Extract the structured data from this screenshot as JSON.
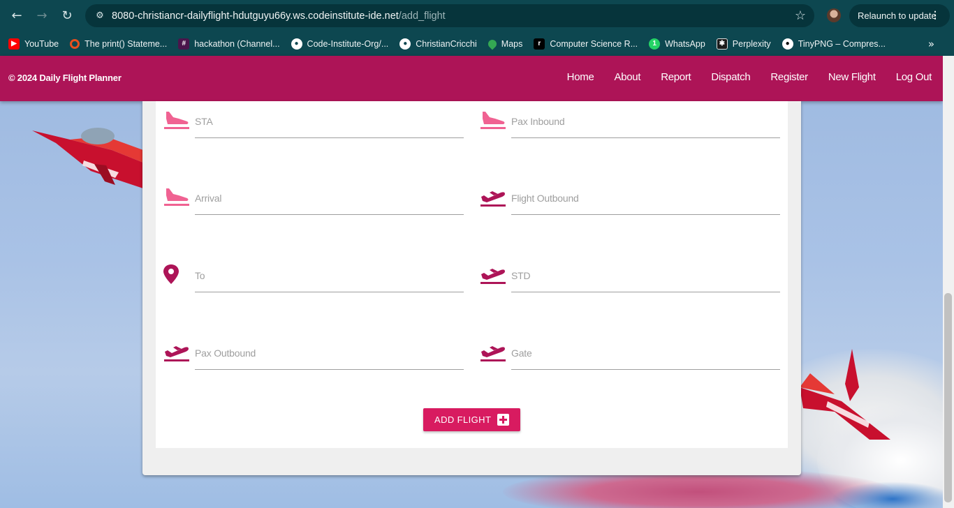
{
  "browser": {
    "url_host": "8080-christiancr-dailyflight-hdutguyu66y.ws.codeinstitute-ide.net",
    "url_path": "/add_flight",
    "relaunch_label": "Relaunch to update",
    "bookmarks": [
      {
        "label": "YouTube",
        "icon": "youtube-icon",
        "color": "#ff0000"
      },
      {
        "label": "The print() Stateme...",
        "icon": "ring-icon",
        "color": "#e8501e"
      },
      {
        "label": "hackathon (Channel...",
        "icon": "slack-icon",
        "color": "#e01e5a"
      },
      {
        "label": "Code-Institute-Org/...",
        "icon": "github-icon",
        "color": "#24292e"
      },
      {
        "label": "ChristianCricchi",
        "icon": "github-icon",
        "color": "#24292e"
      },
      {
        "label": "Maps",
        "icon": "maps-icon",
        "color": "#34a853"
      },
      {
        "label": "Computer Science R...",
        "icon": "r-icon",
        "color": "#000000"
      },
      {
        "label": "WhatsApp",
        "icon": "whatsapp-icon",
        "color": "#25d366"
      },
      {
        "label": "Perplexity",
        "icon": "perplexity-icon",
        "color": "#1b1b1b"
      },
      {
        "label": "TinyPNG – Compres...",
        "icon": "panda-icon",
        "color": "#ffffff"
      }
    ]
  },
  "navbar": {
    "brand": "© 2024 Daily Flight Planner",
    "links": [
      "Home",
      "About",
      "Report",
      "Dispatch",
      "Register",
      "New Flight",
      "Log Out"
    ]
  },
  "form": {
    "fields": [
      {
        "label": "STA",
        "icon": "flight-land-icon"
      },
      {
        "label": "Pax Inbound",
        "icon": "flight-land-icon"
      },
      {
        "label": "Arrival",
        "icon": "flight-land-icon"
      },
      {
        "label": "Flight Outbound",
        "icon": "flight-takeoff-icon"
      },
      {
        "label": "To",
        "icon": "location-pin-icon"
      },
      {
        "label": "STD",
        "icon": "flight-takeoff-icon"
      },
      {
        "label": "Pax Outbound",
        "icon": "flight-takeoff-icon"
      },
      {
        "label": "Gate",
        "icon": "flight-takeoff-icon"
      }
    ],
    "submit_label": "ADD FLIGHT"
  },
  "colors": {
    "navbar": "#ad1457",
    "button": "#d81b60",
    "icon_land": "#f06292",
    "icon_takeoff": "#ad1457"
  }
}
